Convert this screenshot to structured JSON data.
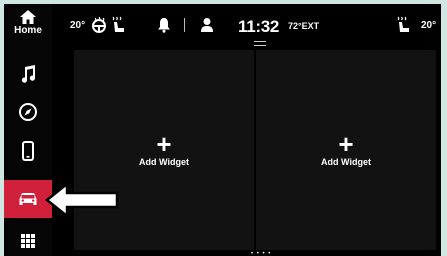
{
  "sidebar": {
    "home_label": "Home",
    "items": [
      {
        "name": "media",
        "icon": "music-note-icon",
        "active": false
      },
      {
        "name": "navigation",
        "icon": "compass-icon",
        "active": false
      },
      {
        "name": "phone",
        "icon": "phone-icon",
        "active": false
      },
      {
        "name": "vehicle",
        "icon": "car-icon",
        "active": true
      },
      {
        "name": "apps",
        "icon": "apps-grid-icon",
        "active": false
      }
    ]
  },
  "status_bar": {
    "left_temp": "20°",
    "right_temp": "20°",
    "time": "11:32",
    "outside_temp": "72°EXT"
  },
  "widgets": [
    {
      "plus": "+",
      "label": "Add Widget"
    },
    {
      "plus": "+",
      "label": "Add Widget"
    }
  ],
  "page_indicator": "• • • •",
  "colors": {
    "active_item": "#d0203a",
    "background": "#000000",
    "frame": "#cfe6e3"
  }
}
